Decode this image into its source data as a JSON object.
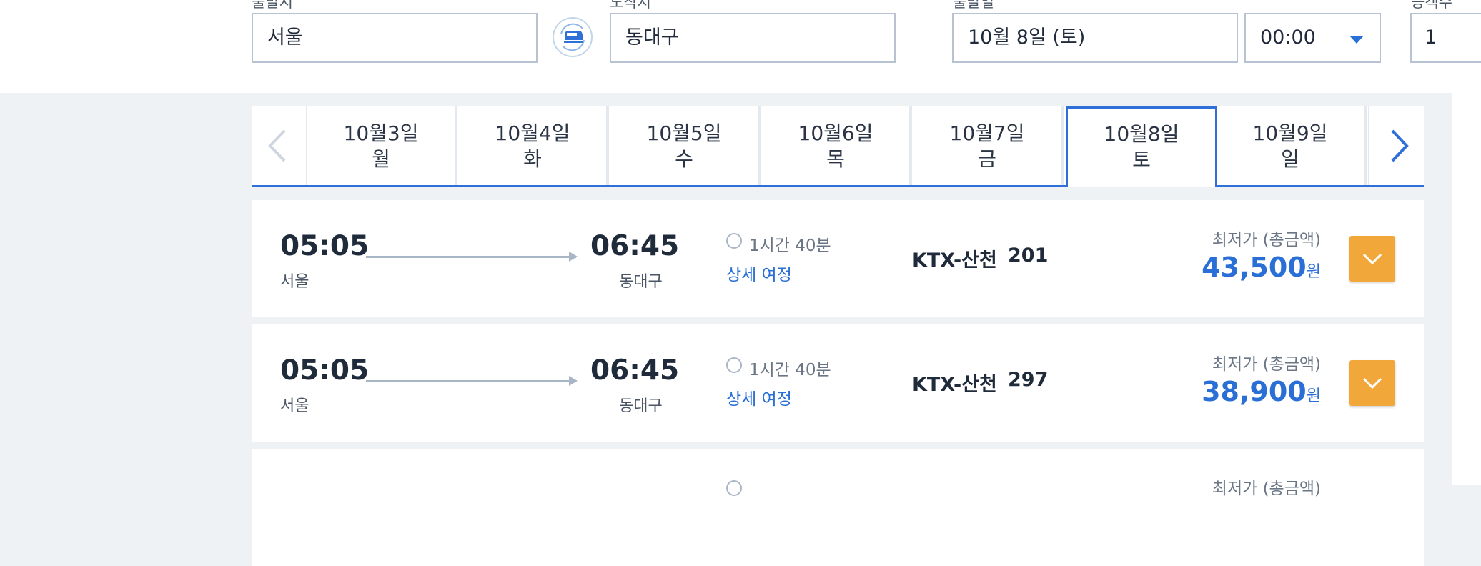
{
  "search": {
    "origin": {
      "label": "출발지",
      "value": "서울"
    },
    "destination": {
      "label": "도착지",
      "value": "동대구"
    },
    "date": {
      "label": "출발일",
      "value": "10월 8일 (토)"
    },
    "time": {
      "value": "00:00"
    },
    "passengers": {
      "label": "승객수",
      "value": "1"
    },
    "swap_icon": "train-swap-icon"
  },
  "date_strip": {
    "prev_icon": "chevron-left-icon",
    "next_icon": "chevron-right-icon",
    "dates": [
      {
        "date": "10월3일",
        "day": "월"
      },
      {
        "date": "10월4일",
        "day": "화"
      },
      {
        "date": "10월5일",
        "day": "수"
      },
      {
        "date": "10월6일",
        "day": "목"
      },
      {
        "date": "10월7일",
        "day": "금"
      },
      {
        "date": "10월8일",
        "day": "토",
        "selected": true
      },
      {
        "date": "10월9일",
        "day": "일"
      }
    ]
  },
  "results": [
    {
      "depart_time": "05:05",
      "depart_station": "서울",
      "arrive_time": "06:45",
      "arrive_station": "동대구",
      "duration": "1시간 40분",
      "detail_link": "상세 여정",
      "train_type": "KTX-산천",
      "train_no": "201",
      "price_label": "최저가 (총금액)",
      "price": "43,500",
      "currency": "원"
    },
    {
      "depart_time": "05:05",
      "depart_station": "서울",
      "arrive_time": "06:45",
      "arrive_station": "동대구",
      "duration": "1시간 40분",
      "detail_link": "상세 여정",
      "train_type": "KTX-산천",
      "train_no": "297",
      "price_label": "최저가 (총금액)",
      "price": "38,900",
      "currency": "원"
    },
    {
      "duration": "",
      "price_label": "최저가 (총금액)"
    }
  ],
  "colors": {
    "accent_blue": "#2f6fd8",
    "price_blue": "#2a6fd6",
    "expand_orange": "#f2a73a",
    "page_bg": "#eef2f5"
  }
}
